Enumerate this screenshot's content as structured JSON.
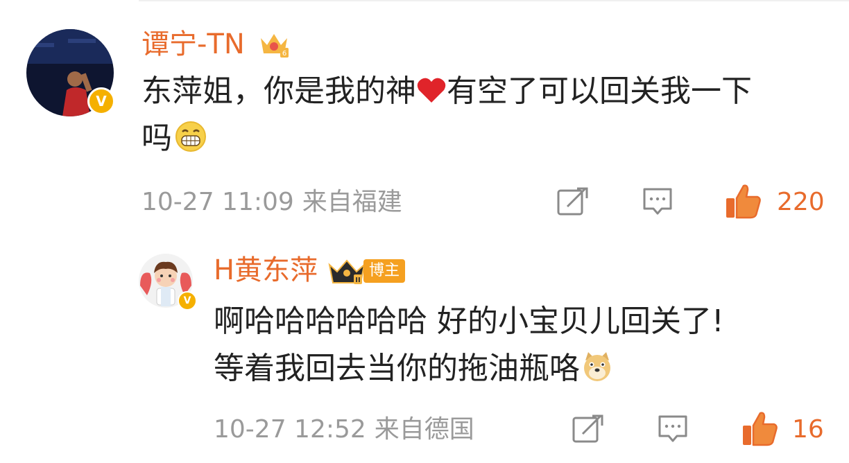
{
  "comments": [
    {
      "username": "谭宁-TN",
      "text_line1": "东萍姐，你是我的神",
      "text_line1b": "有空了可以回关我一下",
      "text_line2": "吗",
      "date": "10-27 11:09",
      "location": "来自福建",
      "likes": "220"
    },
    {
      "username": "H黄东萍",
      "badge": "博主",
      "text_line1": "啊哈哈哈哈哈哈 好的小宝贝儿回关了!",
      "text_line2": "等着我回去当你的拖油瓶咯",
      "date": "10-27 12:52",
      "location": "来自德国",
      "likes": "16"
    }
  ],
  "icons": [
    "crown-level-icon",
    "verified-badge-icon",
    "heart-emoji-icon",
    "grin-emoji-icon",
    "crown-ii-icon",
    "doge-emoji-icon",
    "share-icon",
    "comment-icon",
    "like-icon"
  ],
  "colors": {
    "username": "#e86b2c",
    "meta": "#9a9a9a",
    "text": "#222222",
    "accent": "#f5a020"
  }
}
